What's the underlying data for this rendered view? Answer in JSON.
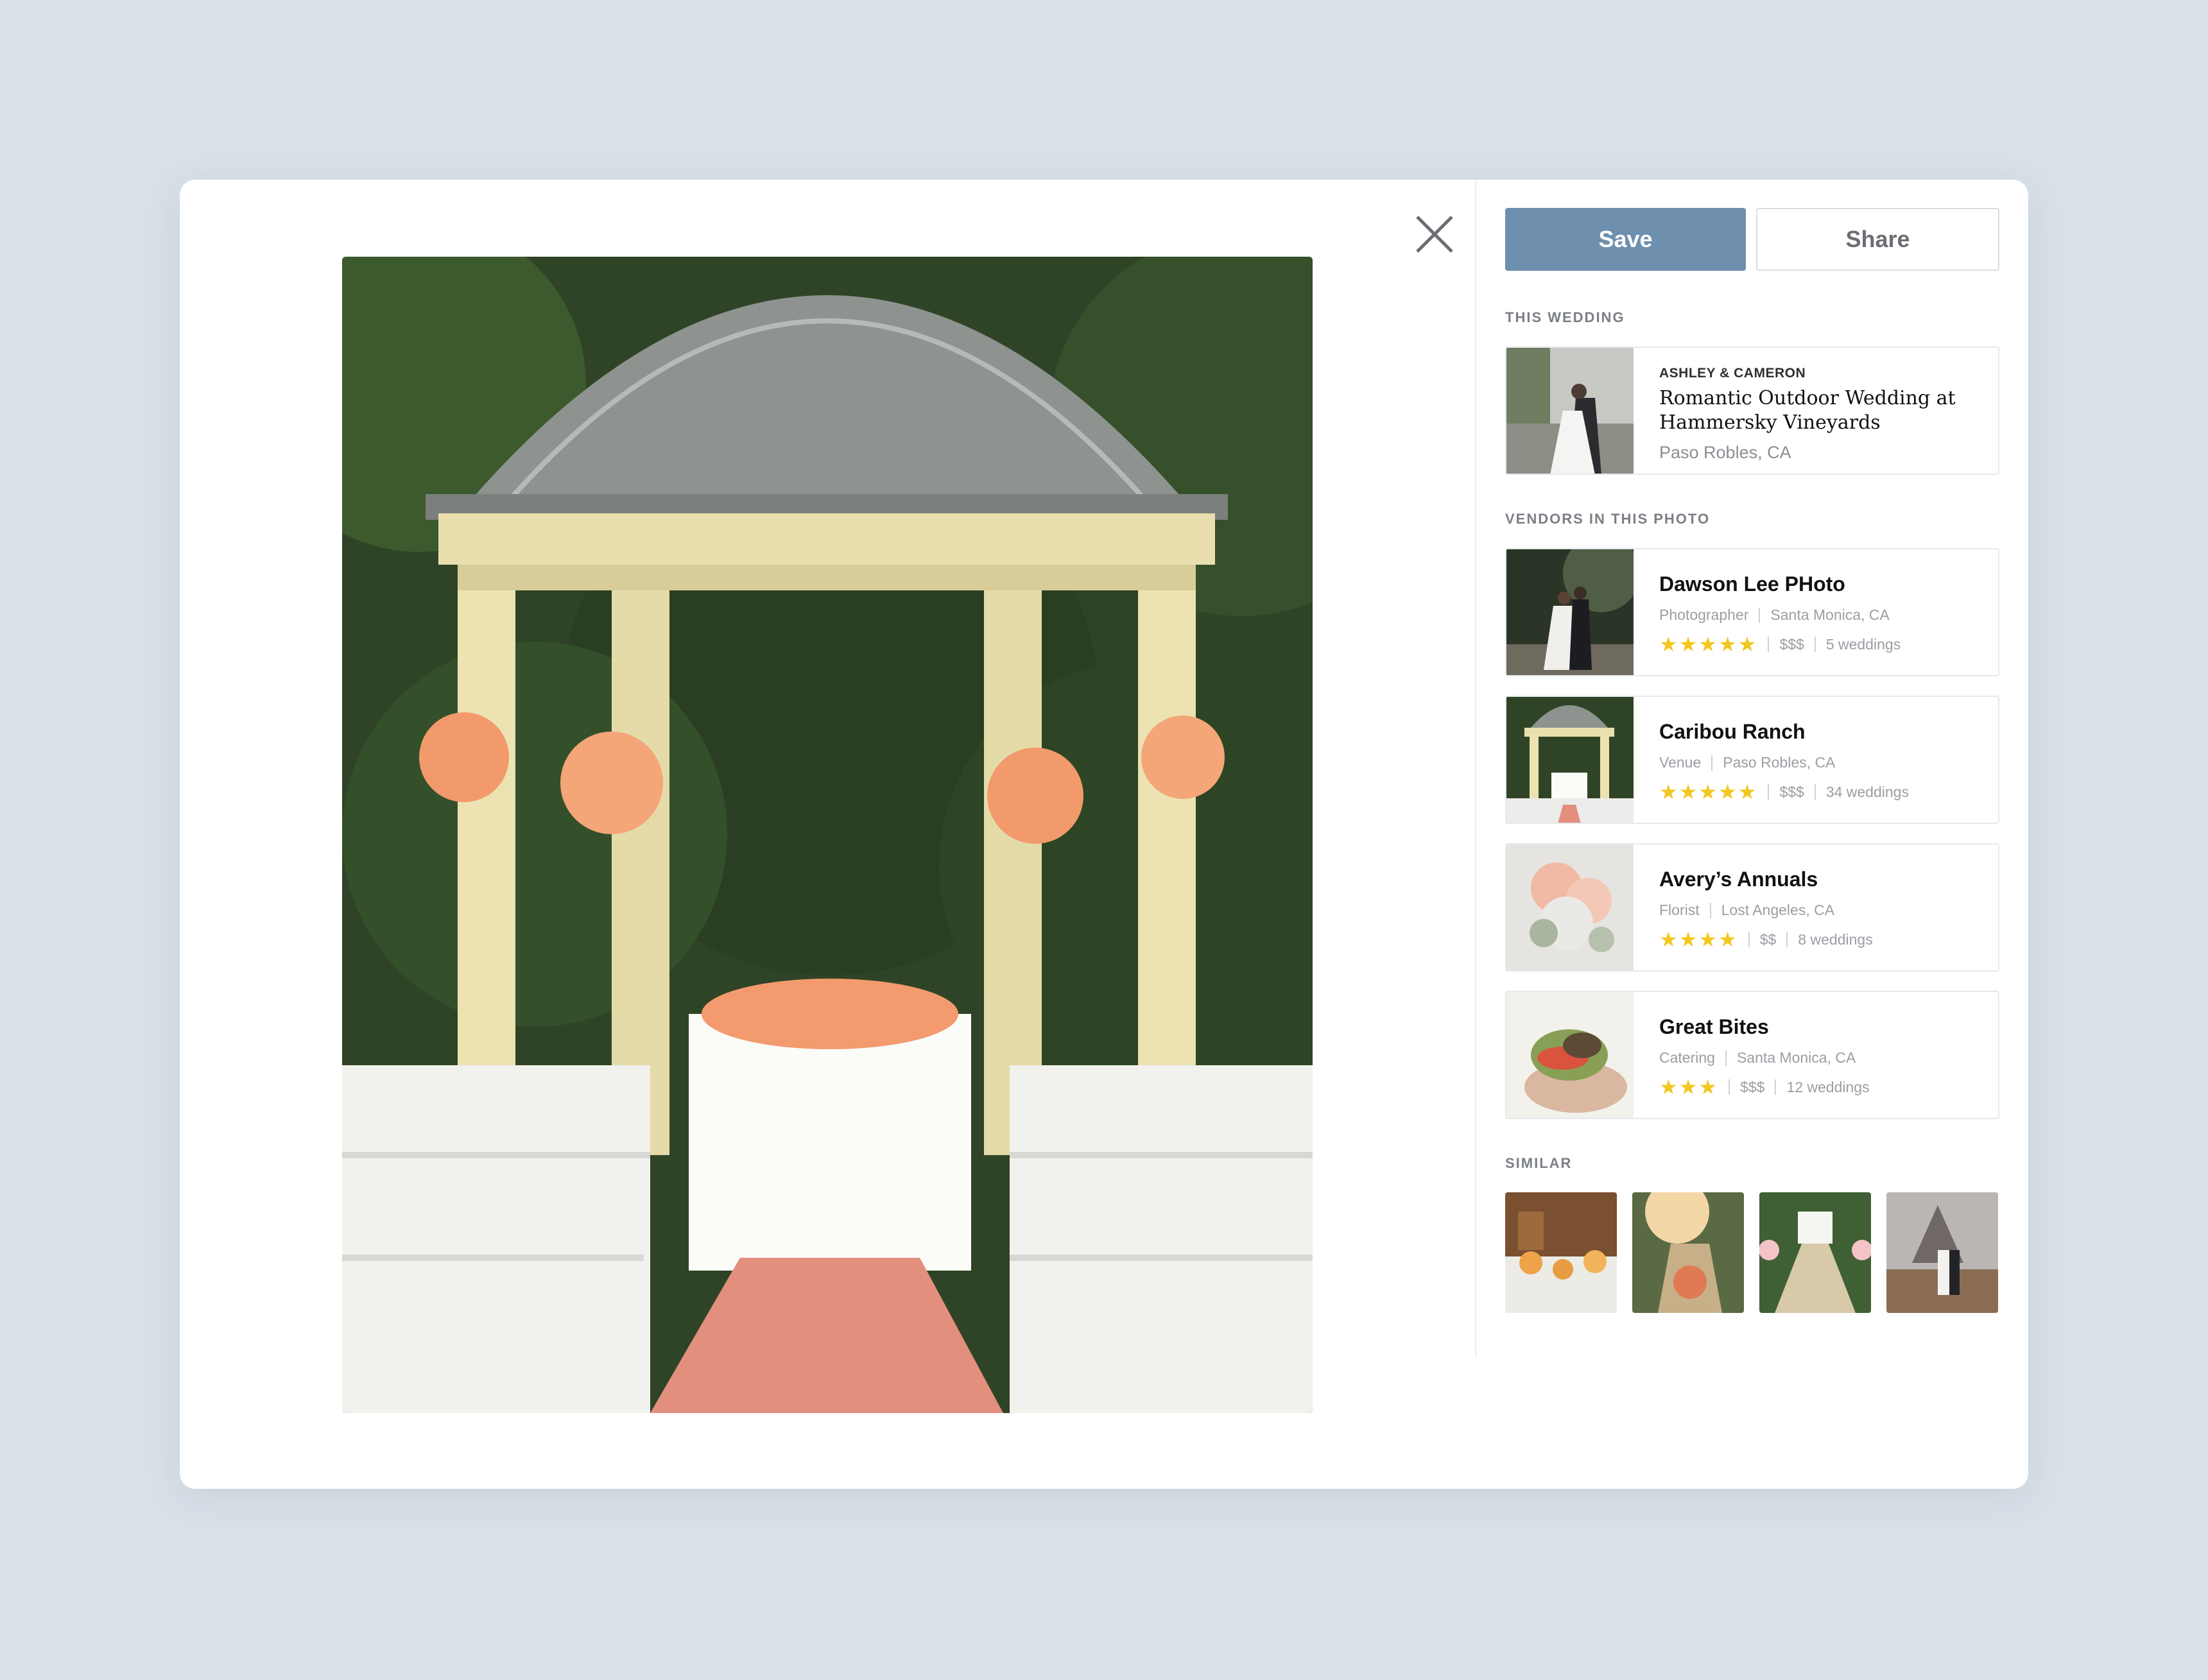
{
  "actions": {
    "save_label": "Save",
    "share_label": "Share"
  },
  "this_wedding": {
    "heading": "THIS WEDDING",
    "couple": "ASHLEY & CAMERON",
    "title": "Romantic Outdoor Wedding at Hammersky Vineyards",
    "location": "Paso Robles, CA"
  },
  "vendors": {
    "heading": "VENDORS IN THIS PHOTO",
    "items": [
      {
        "name": "Dawson Lee PHoto",
        "category": "Photographer",
        "location": "Santa Monica, CA",
        "stars": "★★★★★",
        "rating": 5,
        "price": "$$$",
        "weddings": "5 weddings"
      },
      {
        "name": "Caribou Ranch",
        "category": "Venue",
        "location": "Paso Robles, CA",
        "stars": "★★★★★",
        "rating": 5,
        "price": "$$$",
        "weddings": "34 weddings"
      },
      {
        "name": "Avery’s Annuals",
        "category": "Florist",
        "location": "Lost Angeles, CA",
        "stars": "★★★★",
        "rating": 4,
        "price": "$$",
        "weddings": "8 weddings"
      },
      {
        "name": "Great Bites",
        "category": "Catering",
        "location": "Santa Monica, CA",
        "stars": "★★★",
        "rating": 3,
        "price": "$$$",
        "weddings": "12 weddings"
      }
    ]
  },
  "similar": {
    "heading": "SIMILAR"
  },
  "icons": {
    "close": "close-icon",
    "star": "star-icon"
  },
  "colors": {
    "save_button": "#6f8faf",
    "star": "#f2c71f",
    "background": "#d9e0e8"
  }
}
